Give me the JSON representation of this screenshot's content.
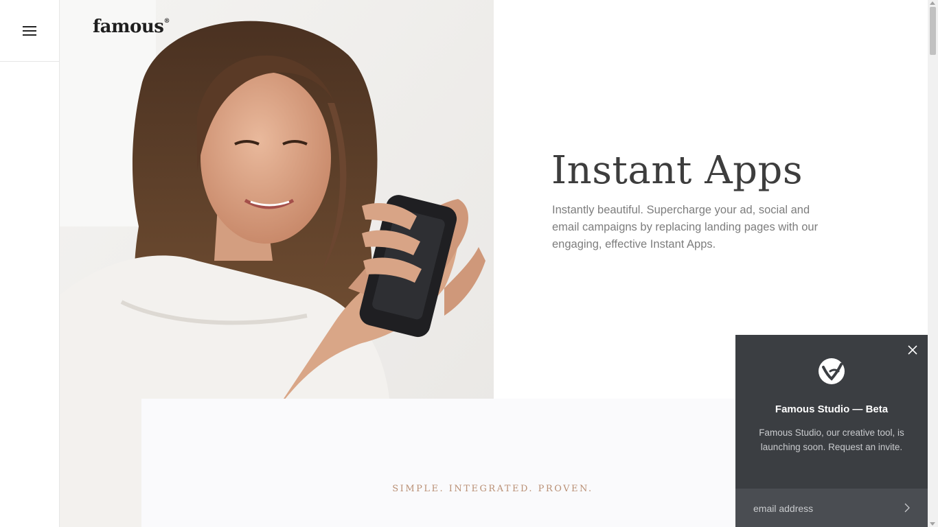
{
  "brand": {
    "logo_text": "famous",
    "logo_mark": "®"
  },
  "nav": {
    "menu_icon": "hamburger-menu-icon"
  },
  "hero": {
    "title": "Instant Apps",
    "description": "Instantly beautiful. Supercharge your ad, social and email campaigns by replacing landing pages with our engaging, effective Instant Apps."
  },
  "section": {
    "tagline": "SIMPLE. INTEGRATED. PROVEN."
  },
  "popup": {
    "title": "Famous Studio — Beta",
    "description": "Famous Studio, our creative tool, is launching soon. Request an invite.",
    "email_placeholder": "email address",
    "close_icon": "close-icon",
    "submit_icon": "chevron-right-icon"
  },
  "colors": {
    "popup_bg": "#3b3e42",
    "tagline": "#b98f74",
    "headline": "#3d3d3d"
  }
}
